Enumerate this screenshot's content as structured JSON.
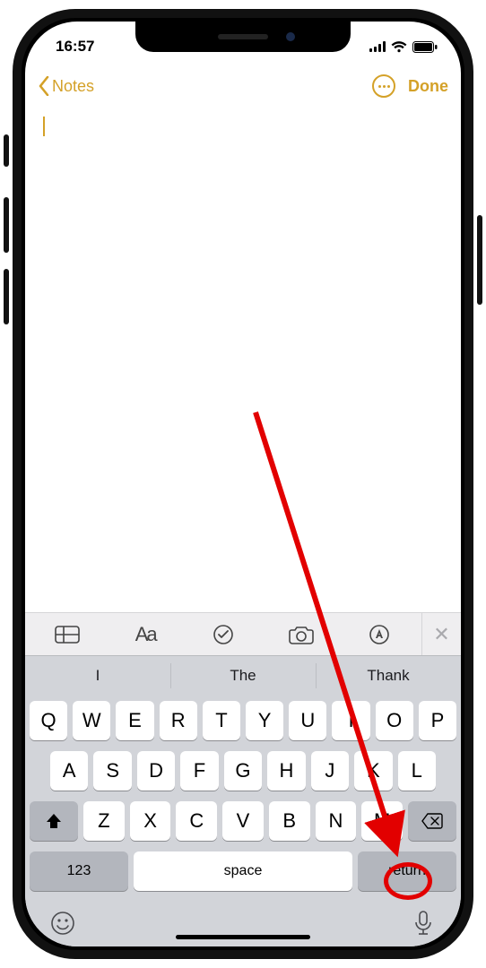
{
  "status": {
    "time": "16:57"
  },
  "nav": {
    "back_label": "Notes",
    "done_label": "Done"
  },
  "toolbar": {
    "text_style_label": "Aa",
    "close_label": "✕"
  },
  "keyboard": {
    "suggestions": [
      "I",
      "The",
      "Thank"
    ],
    "row1": [
      "Q",
      "W",
      "E",
      "R",
      "T",
      "Y",
      "U",
      "I",
      "O",
      "P"
    ],
    "row2": [
      "A",
      "S",
      "D",
      "F",
      "G",
      "H",
      "J",
      "K",
      "L"
    ],
    "row3": [
      "Z",
      "X",
      "C",
      "V",
      "B",
      "N",
      "M"
    ],
    "numbers_label": "123",
    "space_label": "space",
    "return_label": "return"
  },
  "colors": {
    "accent": "#d4a128",
    "annotation": "#e20000"
  }
}
